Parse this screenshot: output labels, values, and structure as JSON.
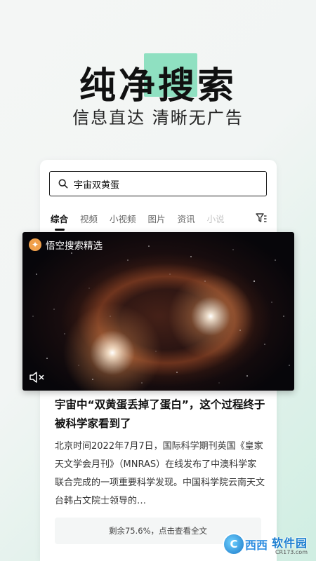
{
  "hero": {
    "headline": "纯净搜索",
    "subline": "信息直达  清晰无广告"
  },
  "search": {
    "query": "宇宙双黄蛋",
    "icon": "search-icon"
  },
  "tabs": [
    "综合",
    "视频",
    "小视频",
    "图片",
    "资讯",
    "小说"
  ],
  "active_tab": "综合",
  "video": {
    "badge": "悟空搜索精选"
  },
  "article": {
    "title": "宇宙中“双黄蛋丢掉了蛋白”，这个过程终于被科学家看到了",
    "body": "北京时间2022年7月7日，国际科学期刊英国《皇家天文学会月刊》（MNRAS）在线发布了中澳科学家联合完成的一项重要科学发现。中国科学院云南天文台韩占文院士领导的…",
    "read_more": "剩余75.6%，点击查看全文"
  },
  "watermark": {
    "left": "西西",
    "main": "软件园",
    "sub": "CR173.com"
  },
  "colors": {
    "accent_green": "#8fe0c1",
    "badge_orange": "#f0a04b",
    "watermark_blue": "#1d7fd1"
  }
}
